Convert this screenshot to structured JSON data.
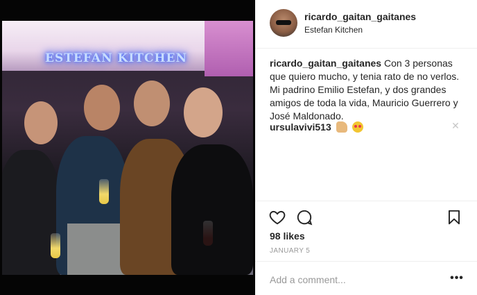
{
  "post": {
    "username": "ricardo_gaitan_gaitanes",
    "location": "Estefan Kitchen",
    "photo_sign_text": "ESTEFAN KITCHEN",
    "caption": {
      "user": "ricardo_gaitan_gaitanes",
      "text": "Con 3 personas que quiero mucho, y tenia rato de no verlos. Mi padrino Emilio Estefan, y dos grandes amigos de toda la vida, Mauricio Guerrero y José Maldonado."
    },
    "comments": [
      {
        "user": "ursulavivi513",
        "emojis": [
          "thumbs-up-emoji",
          "heart-eyes-emoji"
        ]
      }
    ],
    "likes": "98 likes",
    "date": "JANUARY 5",
    "add_comment_placeholder": "Add a comment...",
    "icons": {
      "like": "heart-icon",
      "comment": "comment-bubble-icon",
      "save": "bookmark-icon",
      "more": "more-options-icon",
      "remove_comment": "close-icon"
    },
    "colors": {
      "text": "#262626",
      "muted": "#999999",
      "divider": "#efefef",
      "sign_glow": "#4f7cff"
    }
  }
}
